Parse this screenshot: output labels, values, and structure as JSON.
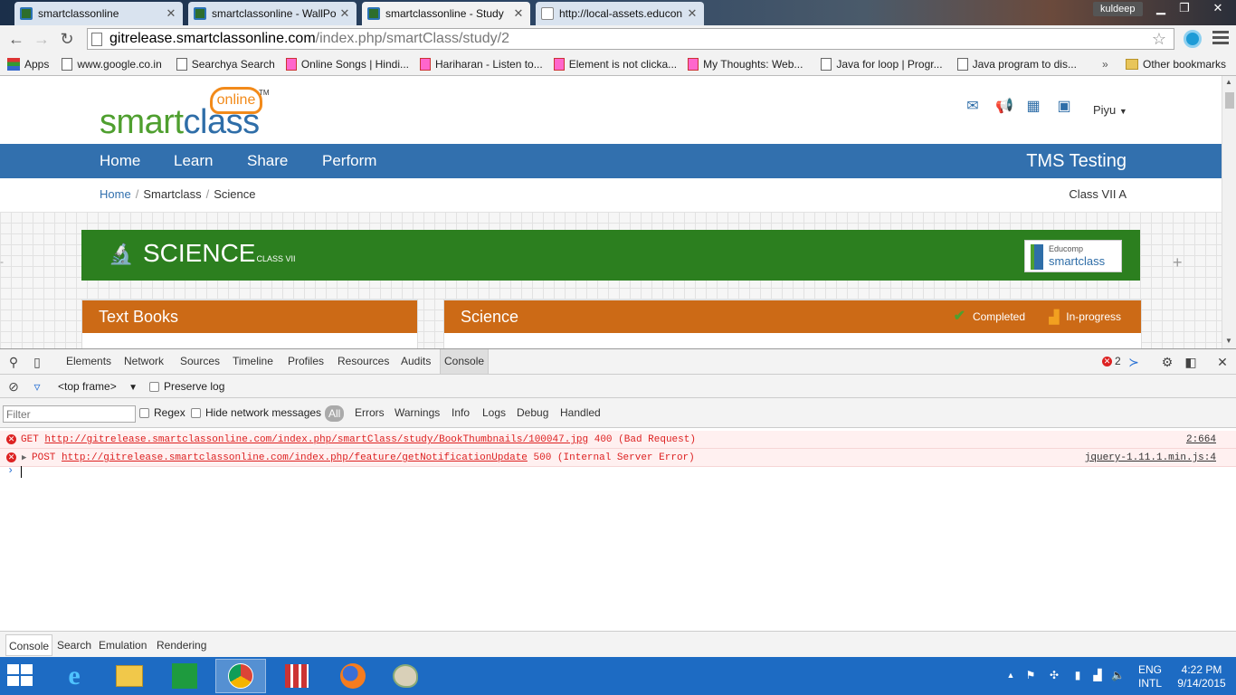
{
  "browser": {
    "tabs": [
      {
        "label": "smartclassonline",
        "icon": "smartclass-favicon"
      },
      {
        "label": "smartclassonline - WallPo",
        "icon": "smartclass-favicon"
      },
      {
        "label": "smartclassonline - Study",
        "icon": "smartclass-favicon"
      },
      {
        "label": "http://local-assets.educon",
        "icon": "page-favicon"
      }
    ],
    "profile_name": "kuldeep",
    "url_host": "gitrelease.smartclassonline.com",
    "url_path": "/index.php/smartClass/study/2",
    "bookmarks": [
      {
        "label": "Apps"
      },
      {
        "label": "www.google.co.in"
      },
      {
        "label": "Searchya Search"
      },
      {
        "label": "Online Songs | Hindi..."
      },
      {
        "label": "Hariharan - Listen to..."
      },
      {
        "label": "Element is not clicka..."
      },
      {
        "label": "My Thoughts: Web..."
      },
      {
        "label": "Java for loop | Progr..."
      },
      {
        "label": "Java program to dis..."
      }
    ],
    "bookmarks_overflow": "»",
    "other_bookmarks": "Other bookmarks"
  },
  "site": {
    "logo_smart": "smart",
    "logo_class": "class",
    "logo_online": "online",
    "logo_tm": "TM",
    "user_menu": "Piyu",
    "nav": [
      "Home",
      "Learn",
      "Share",
      "Perform"
    ],
    "site_title": "TMS Testing",
    "breadcrumb": [
      "Home",
      "Smartclass",
      "Science"
    ],
    "class_label": "Class VII A",
    "subject": "SCIENCE",
    "subject_class": "CLASS VII",
    "partner_logo_top": "Educomp",
    "partner_logo_main": "smartclass",
    "panel_left_title": "Text Books",
    "panel_right_title": "Science",
    "legend_completed": "Completed",
    "legend_inprogress": "In-progress"
  },
  "devtools": {
    "tabs": [
      "Elements",
      "Network",
      "Sources",
      "Timeline",
      "Profiles",
      "Resources",
      "Audits",
      "Console"
    ],
    "error_count": "2",
    "context": "<top frame>",
    "preserve_log": "Preserve log",
    "filter_placeholder": "Filter",
    "regex": "Regex",
    "hide_network": "Hide network messages",
    "levels": [
      "All",
      "Errors",
      "Warnings",
      "Info",
      "Logs",
      "Debug",
      "Handled"
    ],
    "log": [
      {
        "method": "GET",
        "url": "http://gitrelease.smartclassonline.com/index.php/smartClass/study/BookThumbnails/100047.jpg",
        "status": "400 (Bad Request)",
        "source": "2:664"
      },
      {
        "method": "POST",
        "url": "http://gitrelease.smartclassonline.com/index.php/feature/getNotificationUpdate",
        "status": "500 (Internal Server Error)",
        "source": "jquery-1.11.1.min.js:4"
      }
    ],
    "drawer_tabs": [
      "Console",
      "Search",
      "Emulation",
      "Rendering"
    ]
  },
  "taskbar": {
    "language": "ENG",
    "layout": "INTL",
    "time": "4:22 PM",
    "date": "9/14/2015"
  }
}
